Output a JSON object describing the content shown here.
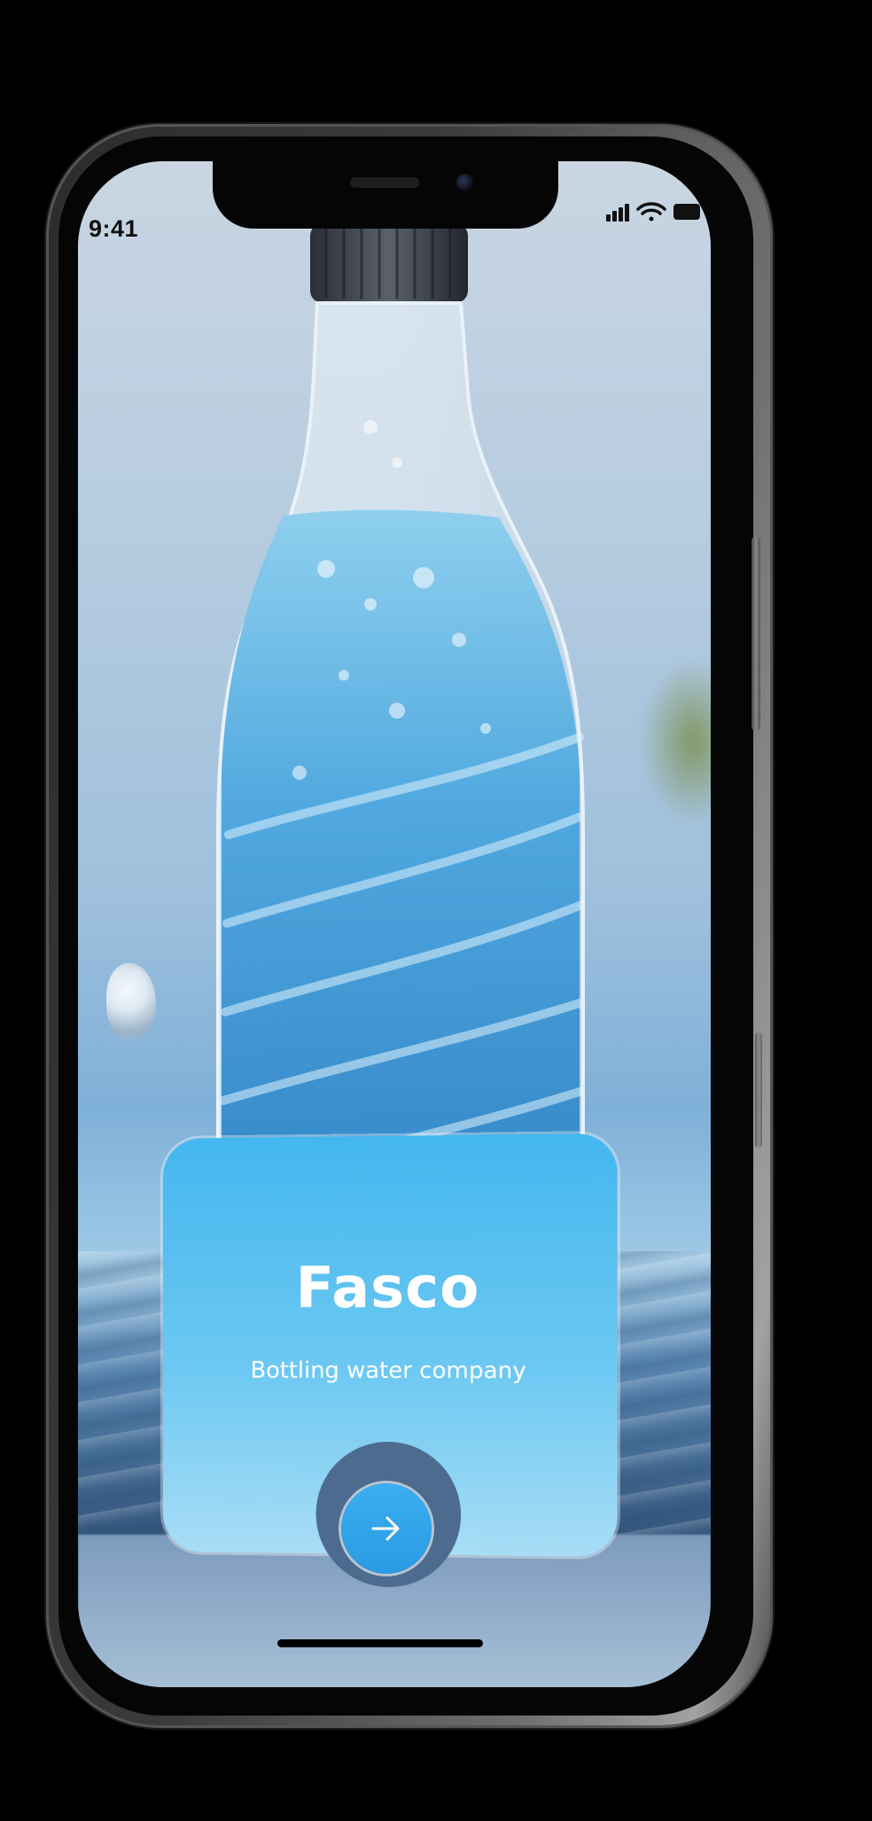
{
  "status_bar": {
    "time": "9:41",
    "icons": [
      "cellular-signal-icon",
      "wifi-icon",
      "battery-icon"
    ]
  },
  "hero": {
    "image": "water-bottle-photo"
  },
  "card": {
    "title": "Fasco",
    "subtitle": "Bottling water company",
    "button_icon": "arrow-right-icon"
  },
  "colors": {
    "accent": "#43b7ef",
    "card_bottom": "#a8ddf5",
    "button": "#2a9be3",
    "text_on_card": "#ffffff"
  }
}
